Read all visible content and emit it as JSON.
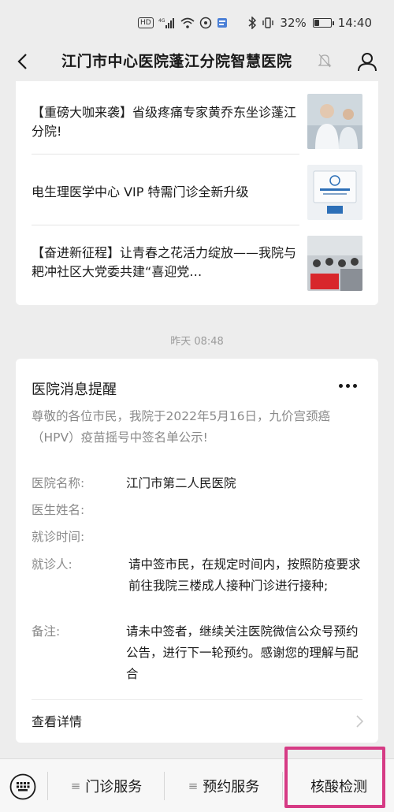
{
  "status_bar": {
    "left_badge": "HD",
    "network": "4G",
    "battery_text": "32%",
    "battery_level": 0.32,
    "time": "14:40"
  },
  "header": {
    "title": "江门市中心医院蓬江分院智慧医院",
    "back_icon": "chevron-left-icon",
    "mute_icon": "bell-muted-icon",
    "profile_icon": "person-icon"
  },
  "articles": [
    {
      "title": "【重磅大咖来袭】省级疼痛专家黄乔东坐诊蓬江分院!",
      "thumb": "doctor-photo"
    },
    {
      "title": "电生理医学中心 VIP 特需门诊全新升级",
      "thumb": "clinic-sign-photo"
    },
    {
      "title": "【奋进新征程】让青春之花活力绽放——我院与耙冲社区大党委共建“喜迎党…",
      "thumb": "group-photo"
    }
  ],
  "timestamp": "昨天 08:48",
  "notice": {
    "title": "医院消息提醒",
    "description": "尊敬的各位市民，我院于2022年5月16日，九价宫颈癌（HPV）疫苗摇号中签名单公示!",
    "fields": [
      {
        "label": "医院名称:",
        "value": "江门市第二人民医院"
      },
      {
        "label": "医生姓名:",
        "value": ""
      },
      {
        "label": "就诊时间:",
        "value": ""
      },
      {
        "label": "就诊人:",
        "value": "请中签市民，在规定时间内，按照防疫要求前往我院三楼成人接种门诊进行接种;"
      },
      {
        "label": "备注:",
        "value": "请未中签者，继续关注医院微信公众号预约公告，进行下一轮预约。感谢您的理解与配合"
      }
    ],
    "view_detail": "查看详情"
  },
  "bottom_menu": {
    "keyboard_icon": "keyboard-icon",
    "items": [
      {
        "label": "门诊服务",
        "has_submenu": true
      },
      {
        "label": "预约服务",
        "has_submenu": true
      },
      {
        "label": "核酸检测",
        "has_submenu": false
      }
    ],
    "submenu_marker": "≡",
    "highlight_color": "#d63b85"
  }
}
